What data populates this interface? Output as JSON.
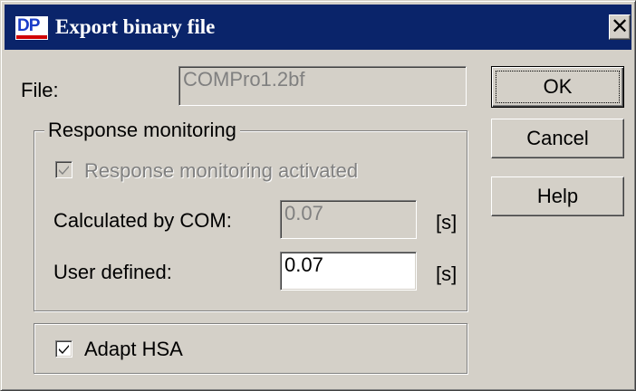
{
  "window": {
    "title": "Export binary file",
    "icon_text": "DP",
    "close_glyph": "✕"
  },
  "file": {
    "label": "File:",
    "value": "COMPro1.2bf"
  },
  "response_group": {
    "title": "Response monitoring",
    "activated_checkbox": {
      "label": "Response monitoring activated",
      "checked": true,
      "enabled": false
    },
    "calculated": {
      "label": "Calculated by COM:",
      "value": "0.07",
      "unit": "[s]"
    },
    "user_defined": {
      "label": "User defined:",
      "value": "0.07",
      "unit": "[s]"
    }
  },
  "hsa_group": {
    "adapt_checkbox": {
      "label": "Adapt HSA",
      "checked": true,
      "enabled": true
    }
  },
  "buttons": {
    "ok": "OK",
    "cancel": "Cancel",
    "help": "Help"
  },
  "colors": {
    "titlebar": "#0a246a",
    "face": "#d4d0c8",
    "disabled_text": "#808080"
  }
}
